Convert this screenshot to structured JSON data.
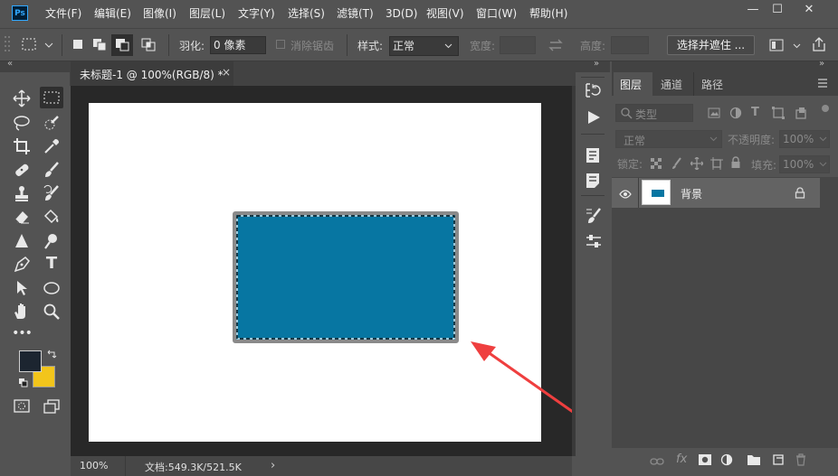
{
  "app": {
    "logo": "Ps"
  },
  "menu": [
    "文件(F)",
    "编辑(E)",
    "图像(I)",
    "图层(L)",
    "文字(Y)",
    "选择(S)",
    "滤镜(T)",
    "3D(D)",
    "视图(V)",
    "窗口(W)",
    "帮助(H)"
  ],
  "window_controls": {
    "minimize": "—",
    "maximize": "☐",
    "close": "✕"
  },
  "options": {
    "feather_label": "羽化:",
    "feather_value": "0 像素",
    "antialias_label": "消除锯齿",
    "style_label": "样式:",
    "style_value": "正常",
    "width_label": "宽度:",
    "height_label": "高度:",
    "select_mask_button": "选择并遮住 ..."
  },
  "document": {
    "tab_title": "未标题-1 @ 100%(RGB/8) *",
    "tab_close": "×",
    "zoom": "100%",
    "doc_info": "文档:549.3K/521.5K",
    "status_arrow": "›"
  },
  "colors": {
    "foreground": "#1c2530",
    "background": "#f2c51b",
    "rect_fill": "#0776a2",
    "rect_border": "#8a8a8a",
    "canvas": "#ffffff",
    "arrow": "#ef3f3f"
  },
  "layers_panel": {
    "tabs": [
      "图层",
      "通道",
      "路径"
    ],
    "filter_placeholder": "类型",
    "blend_mode": "正常",
    "opacity_label": "不透明度:",
    "opacity_value": "100%",
    "lock_label": "锁定:",
    "fill_label": "填充:",
    "fill_value": "100%",
    "layers": [
      {
        "name": "背景",
        "visible": true,
        "locked": true
      }
    ],
    "footer_icons": [
      "link-icon",
      "fx-icon",
      "mask-icon",
      "adjustment-icon",
      "group-folder-icon",
      "new-layer-icon",
      "trash-icon"
    ],
    "fx_text": "fx"
  },
  "tools": [
    "move-tool-icon",
    "marquee-tool-icon",
    "lasso-tool-icon",
    "quick-select-tool-icon",
    "crop-tool-icon",
    "eyedropper-tool-icon",
    "healing-brush-icon",
    "brush-tool-icon",
    "clone-stamp-icon",
    "history-brush-icon",
    "eraser-tool-icon",
    "paint-bucket-icon",
    "sharpen-tool-icon",
    "dodge-tool-icon",
    "pen-tool-icon",
    "type-tool-icon",
    "path-select-icon",
    "ellipse-tool-icon",
    "hand-tool-icon",
    "zoom-tool-icon",
    "more-tools-icon"
  ],
  "type_tool_glyph": "T",
  "more_tools_glyph": "•••"
}
